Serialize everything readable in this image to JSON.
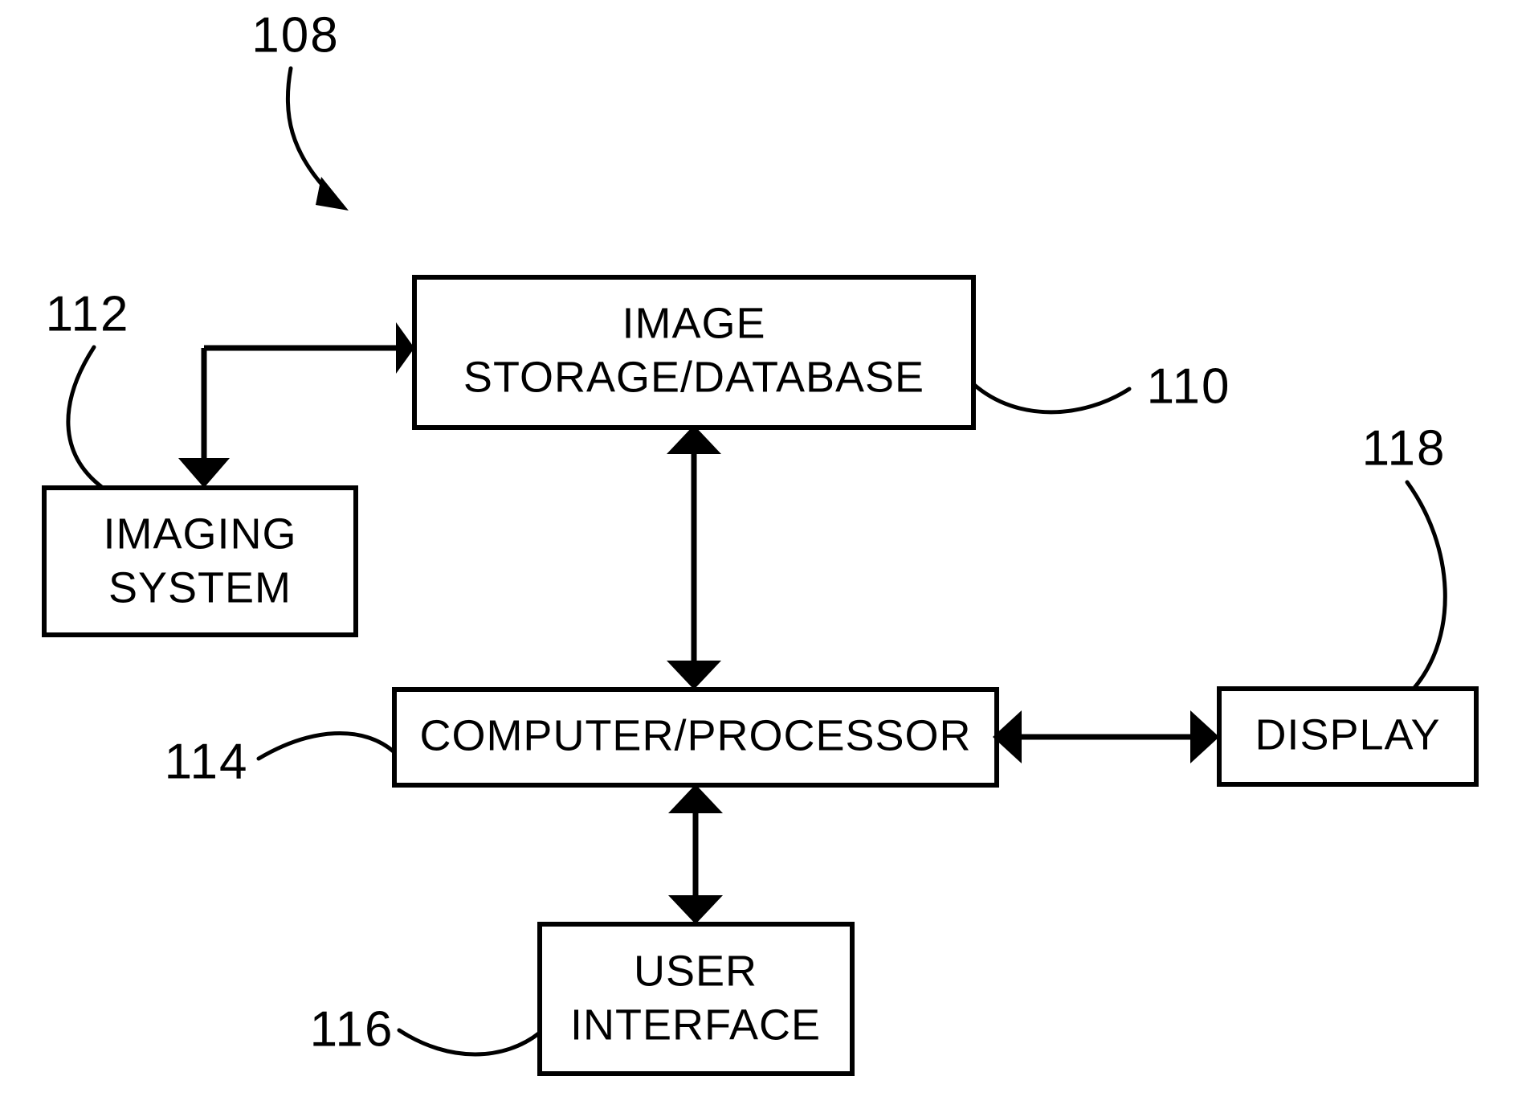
{
  "figure": {
    "number": "108",
    "type": "block-diagram",
    "background_color": "#ffffff",
    "line_color": "#000000"
  },
  "boxes": [
    {
      "id": "image-storage",
      "ref": "110",
      "lines": [
        "IMAGE",
        "STORAGE/DATABASE"
      ],
      "line1": "IMAGE",
      "line2": "STORAGE/DATABASE"
    },
    {
      "id": "imaging-system",
      "ref": "112",
      "lines": [
        "IMAGING",
        "SYSTEM"
      ],
      "line1": "IMAGING",
      "line2": "SYSTEM"
    },
    {
      "id": "computer-processor",
      "ref": "114",
      "lines": [
        "COMPUTER/PROCESSOR"
      ],
      "line1": "COMPUTER/PROCESSOR",
      "line2": ""
    },
    {
      "id": "user-interface",
      "ref": "116",
      "lines": [
        "USER",
        "INTERFACE"
      ],
      "line1": "USER",
      "line2": "INTERFACE"
    },
    {
      "id": "display",
      "ref": "118",
      "lines": [
        "DISPLAY"
      ],
      "line1": "DISPLAY",
      "line2": ""
    }
  ],
  "reference_numerals": {
    "figure": "108",
    "image_storage": "110",
    "imaging_system": "112",
    "computer_processor": "114",
    "user_interface": "116",
    "display": "118"
  },
  "connections": [
    {
      "from": "source-branch",
      "to": "image-storage",
      "style": "single-arrow",
      "direction": "right"
    },
    {
      "from": "source-branch",
      "to": "imaging-system",
      "style": "single-arrow",
      "direction": "down"
    },
    {
      "from": "image-storage",
      "to": "computer-processor",
      "style": "double-arrow",
      "direction": "vertical"
    },
    {
      "from": "computer-processor",
      "to": "display",
      "style": "double-arrow",
      "direction": "horizontal"
    },
    {
      "from": "computer-processor",
      "to": "user-interface",
      "style": "double-arrow",
      "direction": "vertical"
    }
  ]
}
